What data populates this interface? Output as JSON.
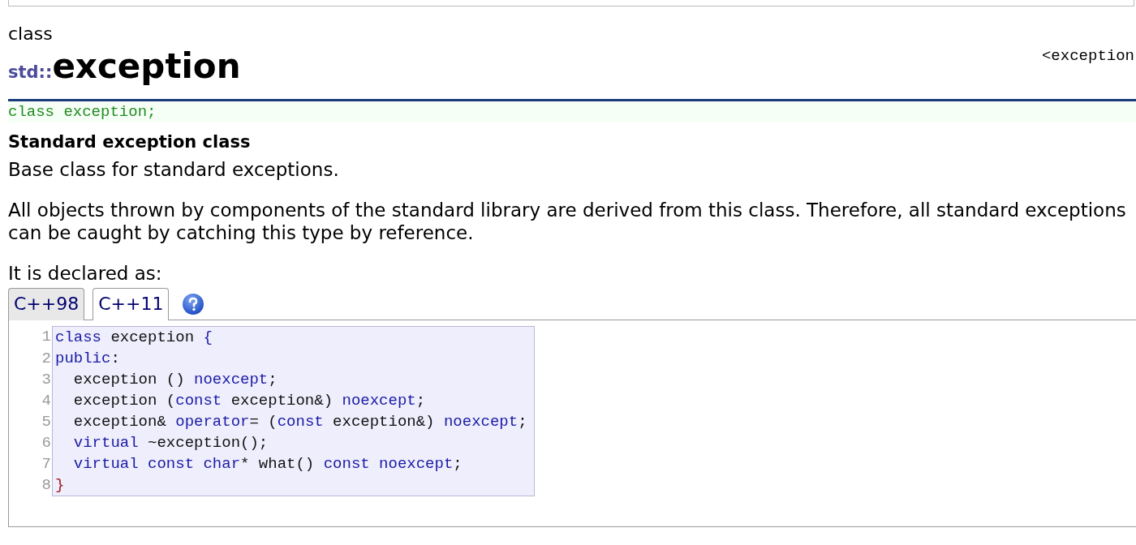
{
  "header": {
    "kind_label": "class",
    "namespace": "std::",
    "name": "exception",
    "header_link": "<exception"
  },
  "declaration": "class exception;",
  "summary": "Standard exception class",
  "paragraphs": [
    [
      "Base class for standard exceptions."
    ],
    [
      "All objects thrown by components of the standard library are derived from this class. Therefore, all standard exceptions",
      "can be caught by catching this type by reference."
    ],
    [
      "It is declared as:"
    ]
  ],
  "tabs": [
    {
      "label": "C++98",
      "selected": false
    },
    {
      "label": "C++11",
      "selected": true
    }
  ],
  "code": [
    {
      "number": "1",
      "tokens": [
        {
          "kind": "keyword",
          "text": "class"
        },
        {
          "kind": "plain",
          "text": " exception "
        },
        {
          "kind": "keyword",
          "text": "{"
        }
      ]
    },
    {
      "number": "2",
      "tokens": [
        {
          "kind": "keyword",
          "text": "public"
        },
        {
          "kind": "plain",
          "text": ":"
        }
      ]
    },
    {
      "number": "3",
      "tokens": [
        {
          "kind": "plain",
          "text": "  exception () "
        },
        {
          "kind": "keyword",
          "text": "noexcept"
        },
        {
          "kind": "plain",
          "text": ";"
        }
      ]
    },
    {
      "number": "4",
      "tokens": [
        {
          "kind": "plain",
          "text": "  exception ("
        },
        {
          "kind": "keyword",
          "text": "const"
        },
        {
          "kind": "plain",
          "text": " exception&) "
        },
        {
          "kind": "keyword",
          "text": "noexcept"
        },
        {
          "kind": "plain",
          "text": ";"
        }
      ]
    },
    {
      "number": "5",
      "tokens": [
        {
          "kind": "plain",
          "text": "  exception& "
        },
        {
          "kind": "keyword",
          "text": "operator"
        },
        {
          "kind": "plain",
          "text": "= ("
        },
        {
          "kind": "keyword",
          "text": "const"
        },
        {
          "kind": "plain",
          "text": " exception&) "
        },
        {
          "kind": "keyword",
          "text": "noexcept"
        },
        {
          "kind": "plain",
          "text": ";"
        }
      ]
    },
    {
      "number": "6",
      "indent": true,
      "tokens": [
        {
          "kind": "keyword",
          "text": "virtual"
        },
        {
          "kind": "plain",
          "text": " ~exception();"
        }
      ]
    },
    {
      "number": "7",
      "indent": true,
      "tokens": [
        {
          "kind": "keyword",
          "text": "virtual const char"
        },
        {
          "kind": "plain",
          "text": "* what() "
        },
        {
          "kind": "keyword",
          "text": "const noexcept"
        },
        {
          "kind": "plain",
          "text": ";"
        }
      ]
    },
    {
      "number": "8",
      "tokens": [
        {
          "kind": "brace",
          "text": "}"
        }
      ]
    }
  ]
}
